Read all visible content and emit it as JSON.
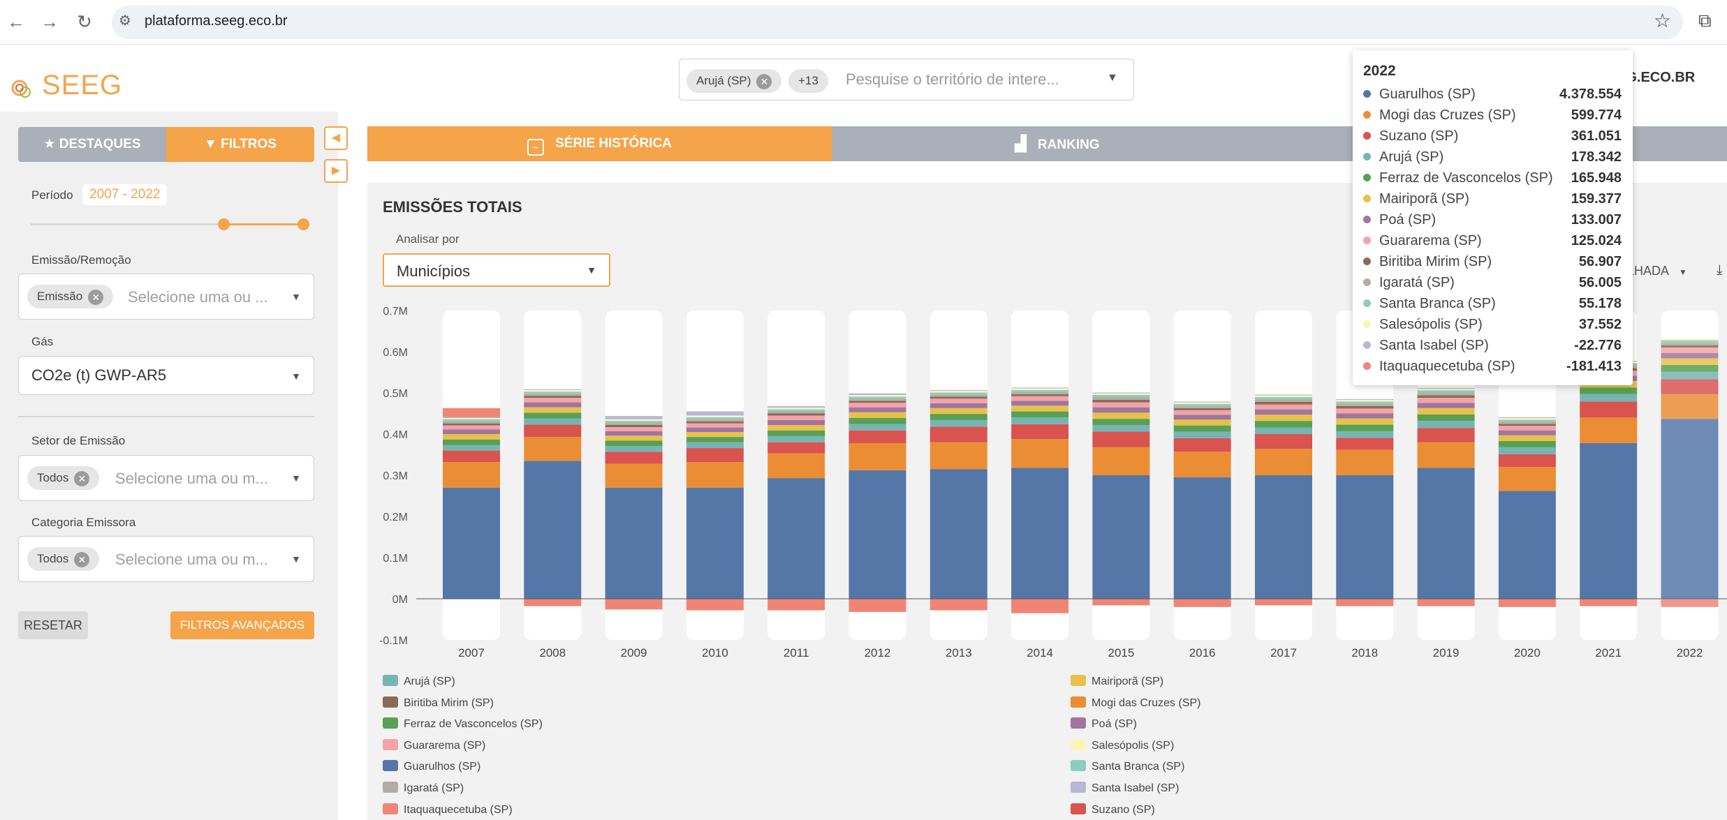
{
  "browser": {
    "url": "plataforma.seeg.eco.br",
    "icons": [
      "back-icon",
      "forward-icon",
      "reload-icon",
      "site-settings-icon",
      "bookmark-star-icon",
      "extensions-icon"
    ]
  },
  "header": {
    "logo_text": "SEEG",
    "search": {
      "chip": "Arujá (SP)",
      "more": "+13",
      "placeholder": "Pesquise o território de intere..."
    },
    "site_link": "EG.ECO.BR"
  },
  "sidebar": {
    "tabs": {
      "highlights": "DESTAQUES",
      "filters": "FILTROS"
    },
    "period_label": "Período",
    "period_value": "2007 - 2022",
    "emission_label": "Emissão/Remoção",
    "emission_chip": "Emissão",
    "emission_placeholder": "Selecione uma ou ...",
    "gas_label": "Gás",
    "gas_value": "CO2e (t) GWP-AR5",
    "sector_label": "Setor de Emissão",
    "sector_chip": "Todos",
    "sector_placeholder": "Selecione uma ou m...",
    "category_label": "Categoria Emissora",
    "category_chip": "Todos",
    "category_placeholder": "Selecione uma ou m...",
    "reset": "RESETAR",
    "advanced": "FILTROS AVANÇADOS"
  },
  "main": {
    "tabs": [
      "SÉRIE HISTÓRICA",
      "RANKING"
    ],
    "panel_title": "EMISSÕES TOTAIS",
    "analyze_label": "Analisar por",
    "analyze_value": "Municípios",
    "view_mode": "LHADA"
  },
  "colors": {
    "accent": "#f5a449",
    "tab_inactive": "#a9b0b9"
  },
  "chart_data": {
    "type": "bar",
    "stacked": true,
    "ylim": [
      -0.1,
      0.7
    ],
    "y_ticks": [
      "-0.1M",
      "0M",
      "0.1M",
      "0.2M",
      "0.3M",
      "0.4M",
      "0.5M",
      "0.6M",
      "0.7M"
    ],
    "categories": [
      "2007",
      "2008",
      "2009",
      "2010",
      "2011",
      "2012",
      "2013",
      "2014",
      "2015",
      "2016",
      "2017",
      "2018",
      "2019",
      "2020",
      "2021",
      "2022"
    ],
    "series": [
      {
        "name": "Guarulhos (SP)",
        "color": "#5577a8",
        "values": [
          0.27,
          0.335,
          0.27,
          0.27,
          0.293,
          0.312,
          0.315,
          0.318,
          0.3,
          0.295,
          0.3,
          0.3,
          0.318,
          0.262,
          0.378,
          0.437
        ]
      },
      {
        "name": "Mogi das Cruzes (SP)",
        "color": "#eb8d35",
        "values": [
          0.062,
          0.058,
          0.058,
          0.062,
          0.06,
          0.066,
          0.065,
          0.07,
          0.068,
          0.062,
          0.064,
          0.062,
          0.062,
          0.058,
          0.062,
          0.06
        ]
      },
      {
        "name": "Suzano (SP)",
        "color": "#d9534f",
        "values": [
          0.028,
          0.03,
          0.029,
          0.034,
          0.027,
          0.031,
          0.038,
          0.036,
          0.038,
          0.033,
          0.036,
          0.029,
          0.035,
          0.031,
          0.039,
          0.036
        ]
      },
      {
        "name": "Arujá (SP)",
        "color": "#77b4b4",
        "values": [
          0.013,
          0.015,
          0.014,
          0.014,
          0.015,
          0.015,
          0.016,
          0.016,
          0.016,
          0.016,
          0.016,
          0.016,
          0.017,
          0.017,
          0.018,
          0.018
        ]
      },
      {
        "name": "Ferraz de Vasconcelos (SP)",
        "color": "#58a055",
        "values": [
          0.014,
          0.014,
          0.013,
          0.013,
          0.014,
          0.015,
          0.015,
          0.015,
          0.015,
          0.015,
          0.016,
          0.016,
          0.016,
          0.015,
          0.016,
          0.017
        ]
      },
      {
        "name": "Mairiporã (SP)",
        "color": "#e8c14a",
        "values": [
          0.013,
          0.013,
          0.012,
          0.012,
          0.013,
          0.014,
          0.014,
          0.014,
          0.015,
          0.014,
          0.015,
          0.015,
          0.015,
          0.014,
          0.016,
          0.016
        ]
      },
      {
        "name": "Poá (SP)",
        "color": "#a0769e",
        "values": [
          0.011,
          0.012,
          0.011,
          0.011,
          0.012,
          0.012,
          0.012,
          0.012,
          0.013,
          0.012,
          0.013,
          0.012,
          0.013,
          0.012,
          0.013,
          0.013
        ]
      },
      {
        "name": "Guararema (SP)",
        "color": "#f4a3a8",
        "values": [
          0.01,
          0.011,
          0.01,
          0.01,
          0.011,
          0.011,
          0.011,
          0.011,
          0.012,
          0.011,
          0.012,
          0.012,
          0.012,
          0.011,
          0.012,
          0.013
        ]
      },
      {
        "name": "Biritiba Mirim (SP)",
        "color": "#8b6a55",
        "values": [
          0.005,
          0.005,
          0.005,
          0.005,
          0.005,
          0.005,
          0.005,
          0.005,
          0.006,
          0.005,
          0.006,
          0.006,
          0.006,
          0.005,
          0.006,
          0.006
        ]
      },
      {
        "name": "Igaratá (SP)",
        "color": "#b3aca6",
        "values": [
          0.005,
          0.005,
          0.005,
          0.005,
          0.005,
          0.005,
          0.005,
          0.005,
          0.006,
          0.005,
          0.006,
          0.006,
          0.006,
          0.005,
          0.006,
          0.006
        ]
      },
      {
        "name": "Santa Branca (SP)",
        "color": "#8ccdc1",
        "values": [
          0.005,
          0.005,
          0.005,
          0.005,
          0.005,
          0.005,
          0.005,
          0.005,
          0.006,
          0.005,
          0.006,
          0.005,
          0.006,
          0.005,
          0.006,
          0.006
        ]
      },
      {
        "name": "Salesópolis (SP)",
        "color": "#fbf6b8",
        "values": [
          0.003,
          0.004,
          0.004,
          0.004,
          0.004,
          0.004,
          0.004,
          0.004,
          0.004,
          0.004,
          0.004,
          0.004,
          0.004,
          0.004,
          0.004,
          0.004
        ]
      },
      {
        "name": "Santa Isabel (SP)",
        "color": "#b9b6d6",
        "values": [
          0.002,
          0.002,
          0.008,
          0.01,
          0.004,
          0.004,
          0.002,
          0.002,
          0.002,
          0.002,
          0.002,
          0.002,
          0.002,
          0.002,
          0.002,
          -0.002
        ]
      },
      {
        "name": "Itaquaquecetuba (SP)",
        "color": "#f08575",
        "values": [
          0.022,
          -0.018,
          -0.026,
          -0.028,
          -0.028,
          -0.032,
          -0.028,
          -0.035,
          -0.016,
          -0.02,
          -0.016,
          -0.018,
          -0.018,
          -0.02,
          -0.018,
          -0.018
        ]
      }
    ],
    "legend_left": [
      "Arujá (SP)",
      "Biritiba Mirim (SP)",
      "Ferraz de Vasconcelos (SP)",
      "Guararema (SP)",
      "Guarulhos (SP)",
      "Igaratá (SP)",
      "Itaquaquecetuba (SP)"
    ],
    "legend_right": [
      "Mairiporã (SP)",
      "Mogi das Cruzes (SP)",
      "Poá (SP)",
      "Salesópolis (SP)",
      "Santa Branca (SP)",
      "Santa Isabel (SP)",
      "Suzano (SP)"
    ],
    "highlighted_category": "2022"
  },
  "tooltip": {
    "year": "2022",
    "rows": [
      {
        "name": "Guarulhos (SP)",
        "value": "4.378.554",
        "color": "#5577a8"
      },
      {
        "name": "Mogi das Cruzes (SP)",
        "value": "599.774",
        "color": "#eb8d35"
      },
      {
        "name": "Suzano (SP)",
        "value": "361.051",
        "color": "#d9534f"
      },
      {
        "name": "Arujá (SP)",
        "value": "178.342",
        "color": "#77b4b4"
      },
      {
        "name": "Ferraz de Vasconcelos (SP)",
        "value": "165.948",
        "color": "#58a055"
      },
      {
        "name": "Mairiporã (SP)",
        "value": "159.377",
        "color": "#e8c14a"
      },
      {
        "name": "Poá (SP)",
        "value": "133.007",
        "color": "#a0769e"
      },
      {
        "name": "Guararema (SP)",
        "value": "125.024",
        "color": "#f4a3a8"
      },
      {
        "name": "Biritiba Mirim (SP)",
        "value": "56.907",
        "color": "#8b6a55"
      },
      {
        "name": "Igaratá (SP)",
        "value": "56.005",
        "color": "#b3aca6"
      },
      {
        "name": "Santa Branca (SP)",
        "value": "55.178",
        "color": "#8ccdc1"
      },
      {
        "name": "Salesópolis (SP)",
        "value": "37.552",
        "color": "#fbf6b8"
      },
      {
        "name": "Santa Isabel (SP)",
        "value": "-22.776",
        "color": "#b9b6d6"
      },
      {
        "name": "Itaquaquecetuba (SP)",
        "value": "-181.413",
        "color": "#f08575"
      }
    ]
  }
}
